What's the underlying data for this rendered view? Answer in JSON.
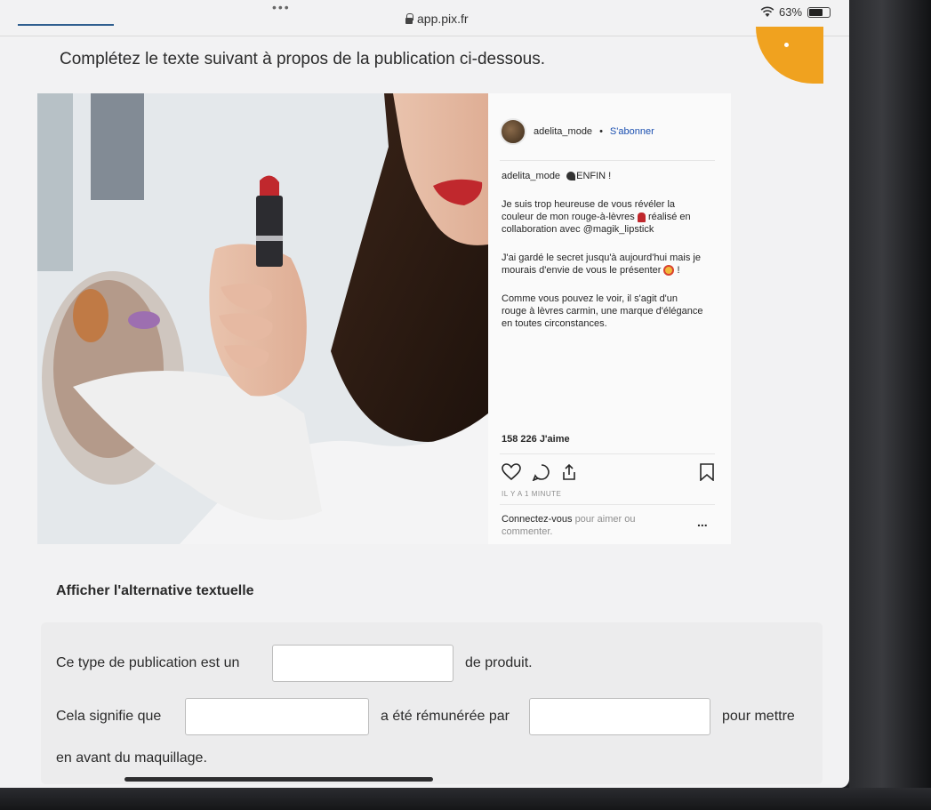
{
  "status_bar": {
    "url": "app.pix.fr",
    "battery": "63%"
  },
  "question": "Complétez le texte suivant à propos de la publication ci-dessous.",
  "post": {
    "username": "adelita_mode",
    "follow": "S'abonner",
    "caption_user": "adelita_mode",
    "caption_headline": "ENFIN !",
    "para1_a": "Je suis trop heureuse de vous révéler la",
    "para1_b": "couleur de mon rouge-à-lèvres",
    "para1_c": "réalisé en",
    "para1_d": "collaboration avec @magik_lipstick",
    "para2_a": "J'ai gardé le secret jusqu'à aujourd'hui mais je",
    "para2_b": "mourais d'envie de vous le présenter",
    "para2_c": "!",
    "para3_a": "Comme vous pouvez le voir, il s'agit d'un",
    "para3_b": "rouge à lèvres carmin, une marque d'élégance",
    "para3_c": "en toutes circonstances.",
    "likes": "158 226 J'aime",
    "time": "IL Y A 1 MINUTE",
    "login_a": "Connectez-vous",
    "login_b": "pour aimer ou",
    "login_c": "commenter.",
    "more": "..."
  },
  "alt_link": "Afficher l'alternative textuelle",
  "exercise": {
    "s1_before": "Ce type de publication est un",
    "s1_after": "de produit.",
    "s2_before": "Cela signifie que",
    "s2_middle": "a été rémunérée par",
    "s2_after": "pour mettre",
    "s3": "en avant du maquillage."
  },
  "colors": {
    "accent": "#f0a21f",
    "lipstick": "#c0282d"
  },
  "icons": [
    "lock-icon",
    "wifi-icon",
    "battery-icon",
    "heart-icon",
    "comment-icon",
    "share-icon",
    "bookmark-icon",
    "more-icon"
  ]
}
